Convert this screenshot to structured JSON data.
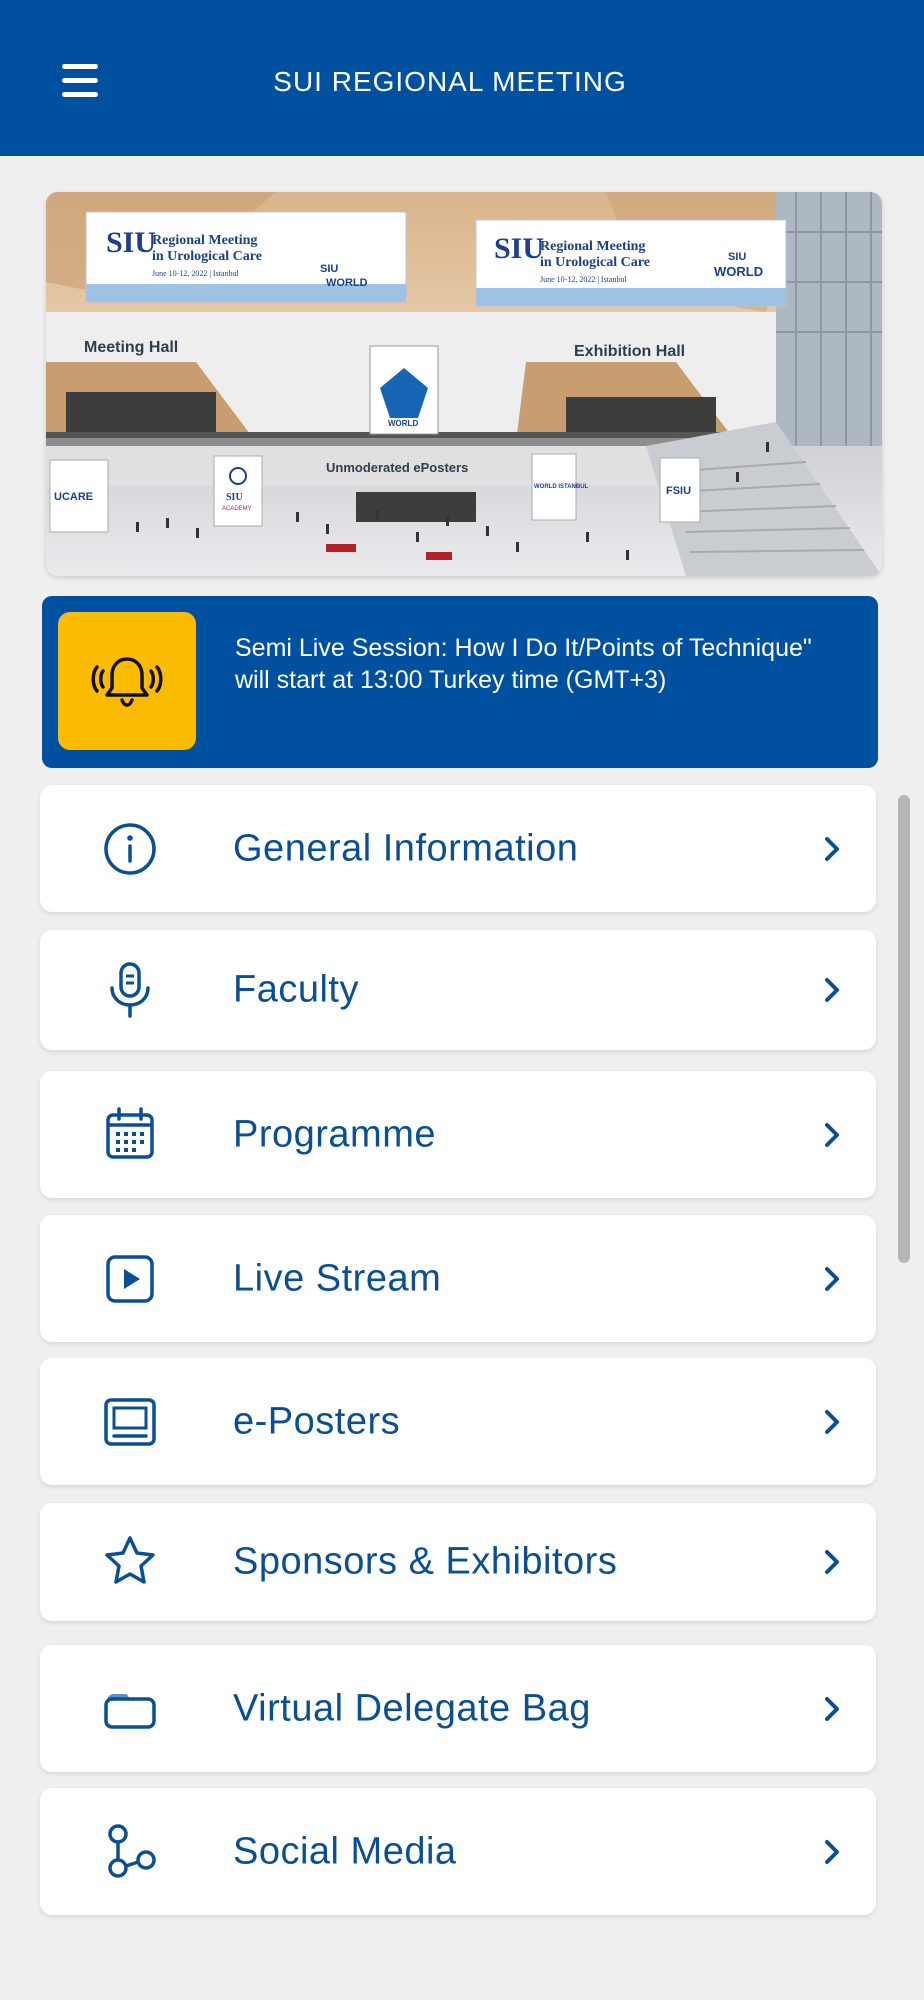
{
  "app": {
    "title": "SUI REGIONAL MEETING",
    "accent_color": "#0050a0",
    "alert_color": "#fbbb00"
  },
  "hero": {
    "banner_left_title": "SIU",
    "banner_left_subtitle_1": "Regional Meeting",
    "banner_left_subtitle_2": "in Urological Care",
    "banner_left_dates": "June 10-12, 2022 | Istanbul",
    "banner_right_title": "SIU",
    "banner_right_subtitle_1": "Regional Meeting",
    "banner_right_subtitle_2": "in Urological Care",
    "banner_right_dates": "June 10-12, 2022 | Istanbul",
    "banner_brand": "SIU",
    "banner_world": "WORLD",
    "meeting_hall": "Meeting Hall",
    "exhibition_hall": "Exhibition Hall",
    "eposters": "Unmoderated ePosters",
    "poster_ucare": "UCARE",
    "poster_academy_1": "SIU",
    "poster_academy_2": "ACADEMY",
    "poster_world_istanbul": "WORLD ISTANBUL",
    "poster_fsiu": "FSIU",
    "center_poster_world": "WORLD"
  },
  "notice": {
    "icon": "bell-ringing-icon",
    "text": "Semi Live Session: How I Do It/Points of Technique\" will start at 13:00 Turkey time (GMT+3)"
  },
  "menu": {
    "items": [
      {
        "label": "General Information",
        "icon": "info-icon"
      },
      {
        "label": "Faculty",
        "icon": "microphone-icon"
      },
      {
        "label": "Programme",
        "icon": "calendar-icon"
      },
      {
        "label": "Live Stream",
        "icon": "play-icon"
      },
      {
        "label": "e-Posters",
        "icon": "laptop-icon"
      },
      {
        "label": "Sponsors & Exhibitors",
        "icon": "star-icon"
      },
      {
        "label": "Virtual Delegate Bag",
        "icon": "folder-icon"
      },
      {
        "label": "Social Media",
        "icon": "share-icon"
      }
    ]
  }
}
